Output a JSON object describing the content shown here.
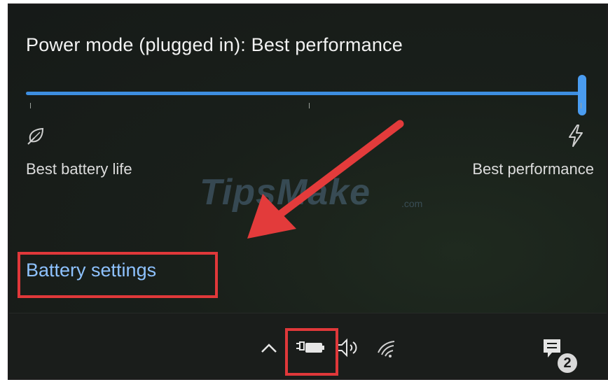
{
  "flyout": {
    "title": "Power mode (plugged in): Best performance",
    "slider_value_label": "Best performance",
    "left_label": "Best battery life",
    "right_label": "Best performance",
    "battery_settings_link": "Battery settings",
    "slider_level": 1.0
  },
  "watermark": {
    "main": "TipsMake",
    "sub": ".com"
  },
  "taskbar": {
    "icons": [
      "chevron-up-icon",
      "battery-charging-icon",
      "volume-icon",
      "wifi-icon",
      "notification-icon"
    ],
    "notification_count": "2"
  },
  "colors": {
    "accent": "#3d8ee0",
    "link": "#8ec2ff",
    "highlight": "#e0383a"
  }
}
